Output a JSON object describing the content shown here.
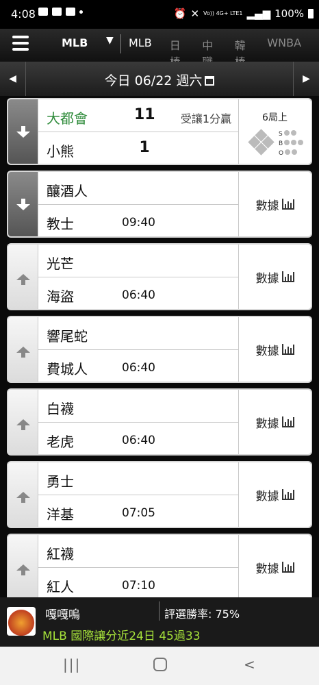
{
  "status_bar": {
    "time": "4:08",
    "right_text": "Vo)) 4G+ LTE1",
    "battery": "100%"
  },
  "top_nav": {
    "current_league": "MLB",
    "tabs": [
      "MLB",
      "日棒",
      "中職",
      "韓棒",
      "WNBA"
    ]
  },
  "date_bar": {
    "label": "今日 06/22 週六"
  },
  "stats_label": "數據",
  "games": [
    {
      "away": "大都會",
      "home": "小熊",
      "away_score": "11",
      "home_score": "1",
      "handicap_result": "受讓1分贏",
      "inning": "6局上",
      "live": true,
      "away_color": "#2e8b3a"
    },
    {
      "away": "釀酒人",
      "home": "教士",
      "time": "09:40",
      "expanded": true
    },
    {
      "away": "光芒",
      "home": "海盜",
      "time": "06:40"
    },
    {
      "away": "響尾蛇",
      "home": "費城人",
      "time": "06:40"
    },
    {
      "away": "白襪",
      "home": "老虎",
      "time": "06:40"
    },
    {
      "away": "勇士",
      "home": "洋基",
      "time": "07:05"
    },
    {
      "away": "紅襪",
      "home": "紅人",
      "time": "07:10"
    }
  ],
  "sbo_labels": [
    "S",
    "B",
    "O"
  ],
  "promo": {
    "name": "嘎嘎嗚",
    "win_rate": "評選勝率: 75%",
    "record": "MLB 國際讓分近24日 45過33"
  },
  "system_nav": {
    "recents": "|||",
    "back": "<"
  }
}
